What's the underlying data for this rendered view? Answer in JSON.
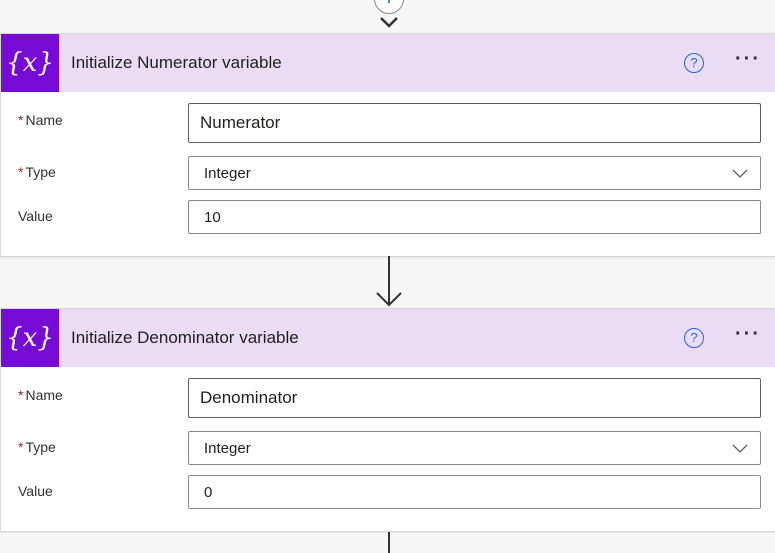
{
  "cards": [
    {
      "icon": "{x}",
      "title": "Initialize Numerator variable",
      "help": "?",
      "more": "···",
      "fields": {
        "name_label": "Name",
        "name_value": "Numerator",
        "type_label": "Type",
        "type_value": "Integer",
        "value_label": "Value",
        "value_value": "10"
      }
    },
    {
      "icon": "{x}",
      "title": "Initialize Denominator variable",
      "help": "?",
      "more": "···",
      "fields": {
        "name_label": "Name",
        "name_value": "Denominator",
        "type_label": "Type",
        "type_value": "Integer",
        "value_label": "Value",
        "value_value": "0"
      }
    }
  ],
  "required_marker": "*",
  "insert_step": "+"
}
